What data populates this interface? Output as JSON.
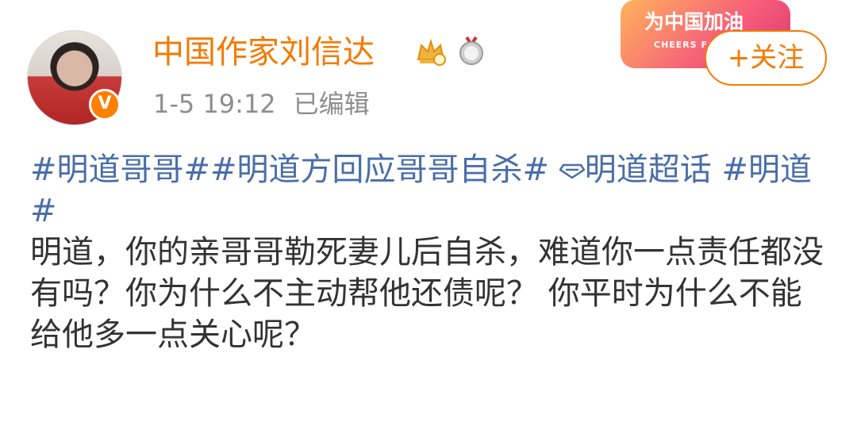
{
  "post": {
    "author": {
      "name": "中国作家刘信达",
      "verified_badge": "V"
    },
    "time": "1-5 19:12",
    "edited_label": "已编辑",
    "campaign_badge": {
      "title": "为中国加油",
      "subtitle": "CHEERS FOR"
    },
    "follow_label": "+关注",
    "topics": [
      "#明道哥哥#",
      "#明道方回应哥哥自杀#",
      "明道超话",
      "#明道#"
    ],
    "body": [
      "明道，你的亲哥哥勒死妻儿后自杀，难道你一点责任都没有吗？你为什么不主动帮他还债呢？ 你平时为什么不能给他多一点关心呢？"
    ]
  },
  "icons": {
    "crown": "crown-icon",
    "medal": "medal-icon",
    "super_topic": "diamond-icon"
  },
  "colors": {
    "username": "#f57900",
    "topic": "#4a6ea9",
    "muted": "#8e8e8e",
    "text": "#333333",
    "accent": "#f57900"
  }
}
